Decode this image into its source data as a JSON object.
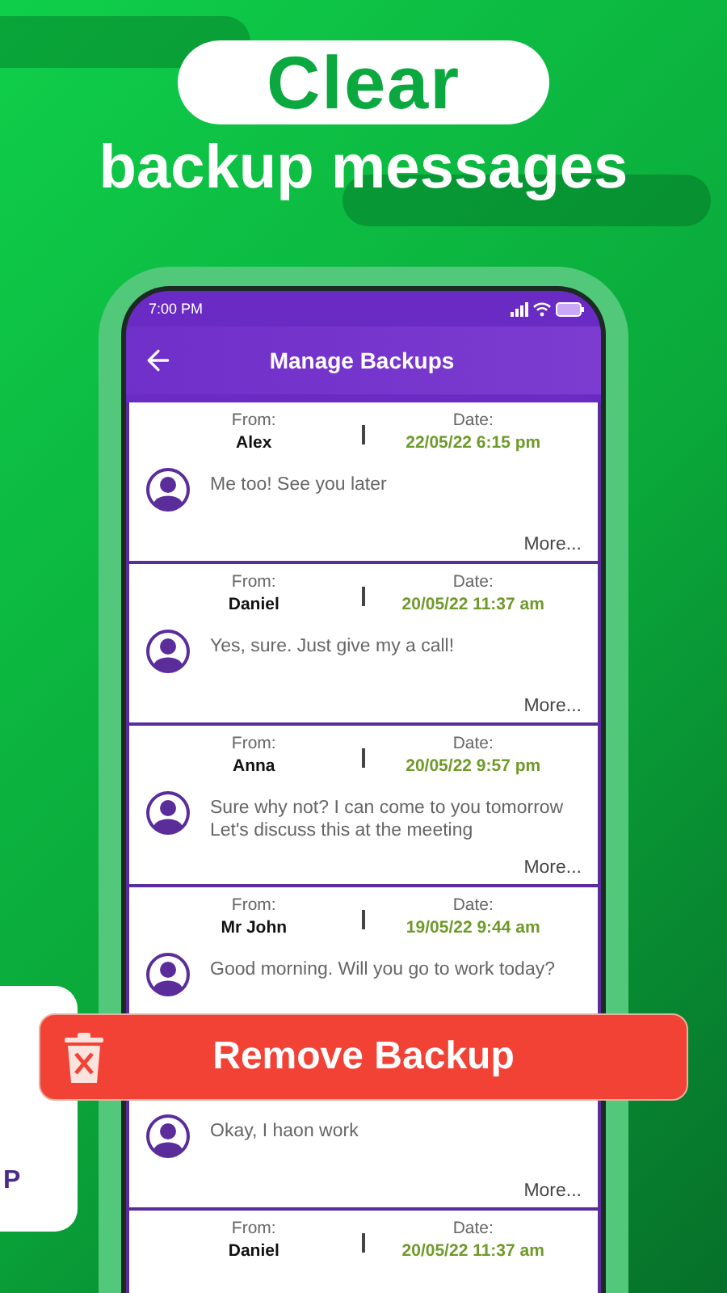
{
  "banner": {
    "highlight": "Clear",
    "subtitle": "backup messages"
  },
  "status_bar": {
    "time": "7:00 PM"
  },
  "app_bar": {
    "title": "Manage Backups"
  },
  "messages": [
    {
      "from_label": "From:",
      "from": "Alex",
      "date_label": "Date:",
      "date": "22/05/22 6:15 pm",
      "text": "Me too! See you later",
      "more": "More..."
    },
    {
      "from_label": "From:",
      "from": "Daniel",
      "date_label": "Date:",
      "date": "20/05/22 11:37 am",
      "text": "Yes, sure. Just give my a call!",
      "more": "More..."
    },
    {
      "from_label": "From:",
      "from": "Anna",
      "date_label": "Date:",
      "date": "20/05/22 9:57 pm",
      "text": "Sure why not? I can come to you tomorrow\nLet's discuss this at the meeting",
      "more": "More..."
    },
    {
      "from_label": "From:",
      "from": "Mr John",
      "date_label": "Date:",
      "date": "19/05/22 9:44 am",
      "text": "Good morning. Will you go to work today?"
    },
    {
      "text": "Okay, I haon work",
      "more": "More..."
    },
    {
      "from_label": "From:",
      "from": "Daniel",
      "date_label": "Date:",
      "date": "20/05/22 11:37 am"
    }
  ],
  "remove_button": {
    "label": "Remove Backup"
  },
  "side_card": {
    "text": "P"
  }
}
